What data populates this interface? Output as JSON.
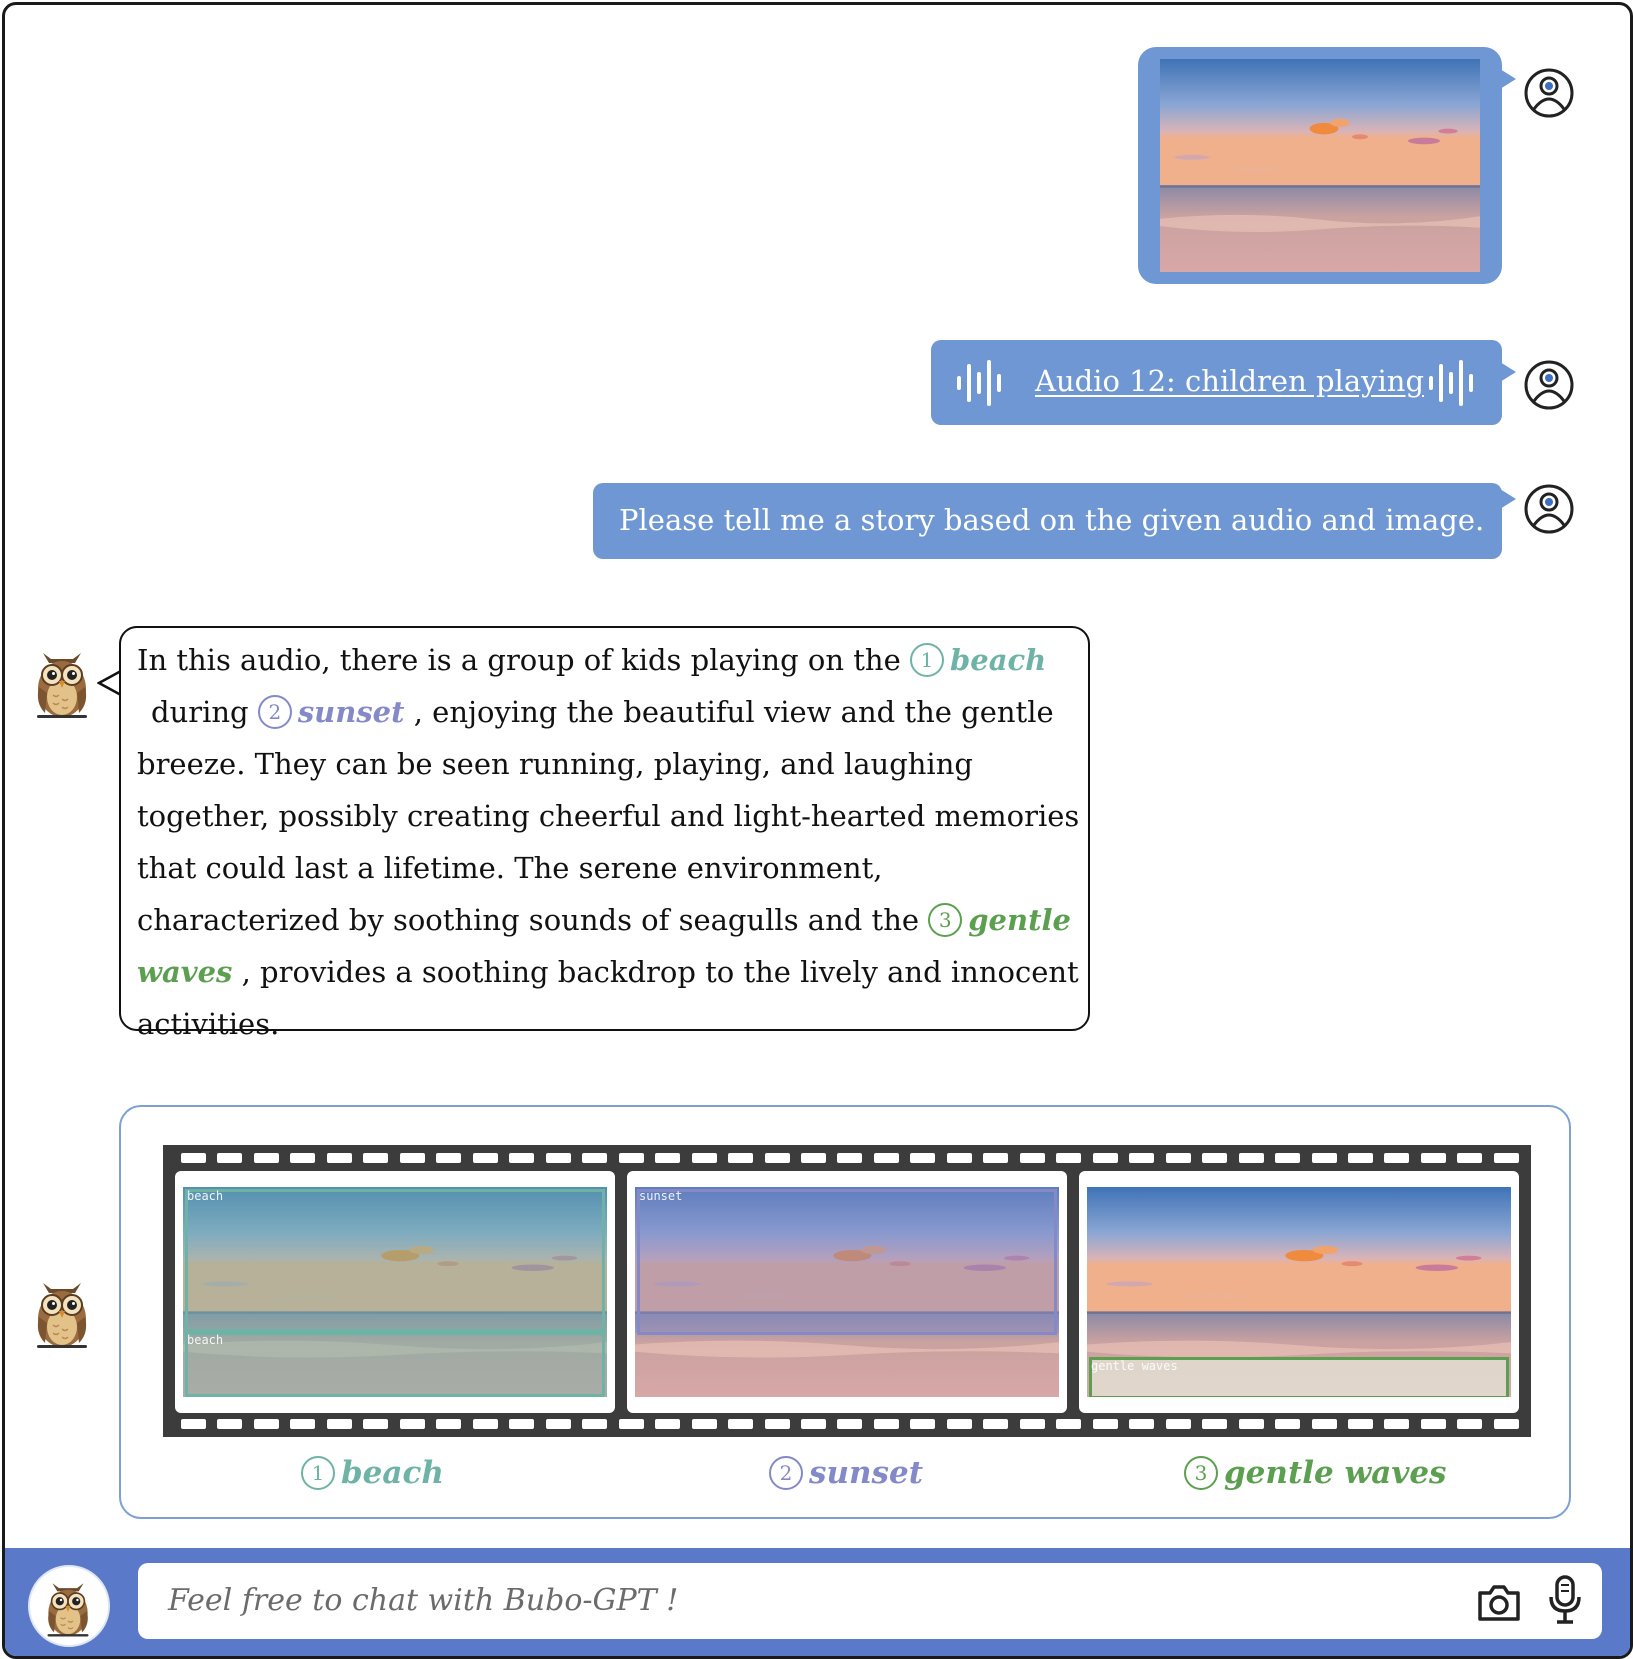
{
  "chat": {
    "audio_label": "Audio 12: children playing",
    "user_prompt": "Please tell me a story based on the given audio and image.",
    "response": {
      "part1": "In this audio, there is a group of kids playing on the ",
      "ref1_num": "1",
      "ref1_word": "beach",
      "part2": " during ",
      "ref2_num": "2",
      "ref2_word": "sunset",
      "part3": " , enjoying the beautiful view and the gentle breeze. They can be seen running, playing, and laughing together, possibly creating cheerful and light-hearted memories that could last a lifetime. The serene environment, characterized by soothing sounds of seagulls and the ",
      "ref3_num": "3",
      "ref3_word": "gentle waves",
      "part4": " , provides a soothing backdrop to the lively and innocent activities."
    }
  },
  "grounding": {
    "frames": [
      {
        "tags": [
          "beach",
          "beach"
        ],
        "caption_num": "1",
        "caption": "beach",
        "color": "#6fb3a6"
      },
      {
        "tags": [
          "sunset"
        ],
        "caption_num": "2",
        "caption": "sunset",
        "color": "#8489c8"
      },
      {
        "tags": [
          "gentle waves"
        ],
        "caption_num": "3",
        "caption": "gentle waves",
        "color": "#5c9f50"
      }
    ]
  },
  "input": {
    "placeholder": "Feel free to chat with Bubo-GPT !",
    "icons": [
      "camera-icon",
      "microphone-icon"
    ]
  },
  "colors": {
    "user_bubble": "#6f97d4",
    "input_bar": "#5a79c8",
    "panel_border": "#7ea0d4"
  }
}
